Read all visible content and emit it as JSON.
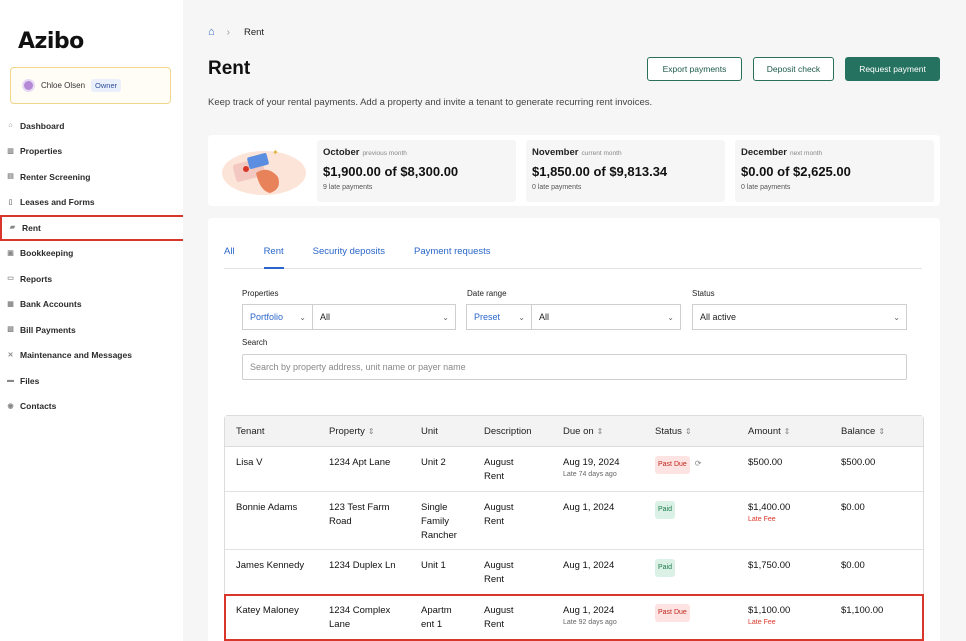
{
  "app": {
    "logo": "Azibo"
  },
  "user": {
    "name": "Chloe Olsen",
    "role": "Owner"
  },
  "sidebar": {
    "items": [
      {
        "label": "Dashboard",
        "icon": "home-icon"
      },
      {
        "label": "Properties",
        "icon": "chart-icon"
      },
      {
        "label": "Renter Screening",
        "icon": "document-icon"
      },
      {
        "label": "Leases and Forms",
        "icon": "file-icon"
      },
      {
        "label": "Rent",
        "icon": "rent-icon",
        "active": true
      },
      {
        "label": "Bookkeeping",
        "icon": "book-icon"
      },
      {
        "label": "Reports",
        "icon": "report-icon"
      },
      {
        "label": "Bank Accounts",
        "icon": "bank-icon"
      },
      {
        "label": "Bill Payments",
        "icon": "bill-icon"
      },
      {
        "label": "Maintenance and Messages",
        "icon": "wrench-icon"
      },
      {
        "label": "Files",
        "icon": "folder-icon"
      },
      {
        "label": "Contacts",
        "icon": "contacts-icon"
      }
    ]
  },
  "breadcrumb": {
    "current": "Rent"
  },
  "header": {
    "title": "Rent",
    "subtitle": "Keep track of your rental payments. Add a property and invite a tenant to generate recurring rent invoices.",
    "export_label": "Export payments",
    "deposit_label": "Deposit check",
    "request_label": "Request payment"
  },
  "summary": [
    {
      "month": "October",
      "note": "previous month",
      "amount": "$1,900.00 of $8,300.00",
      "late": "9 late payments"
    },
    {
      "month": "November",
      "note": "current month",
      "amount": "$1,850.00 of $9,813.34",
      "late": "0 late payments"
    },
    {
      "month": "December",
      "note": "next month",
      "amount": "$0.00 of $2,625.00",
      "late": "0 late payments"
    }
  ],
  "tabs": [
    "All",
    "Rent",
    "Security deposits",
    "Payment requests"
  ],
  "filters": {
    "properties_label": "Properties",
    "properties_scope": "Portfolio",
    "properties_value": "All",
    "date_label": "Date range",
    "date_scope": "Preset",
    "date_value": "All",
    "status_label": "Status",
    "status_value": "All active",
    "search_label": "Search",
    "search_placeholder": "Search by property address, unit name or payer name"
  },
  "table": {
    "columns": [
      "Tenant",
      "Property",
      "Unit",
      "Description",
      "Due on",
      "Status",
      "Amount",
      "Balance"
    ],
    "rows": [
      {
        "tenant": "Lisa V",
        "property": "1234 Apt Lane",
        "unit": "Unit 2",
        "description": "August Rent",
        "due": "Aug 19, 2024",
        "due_sub": "Late 74 days ago",
        "status": "Past Due",
        "amount": "$500.00",
        "amount_sub": "",
        "balance": "$500.00"
      },
      {
        "tenant": "Bonnie Adams",
        "property": "123 Test Farm Road",
        "unit": "Single Family Rancher",
        "description": "August Rent",
        "due": "Aug 1, 2024",
        "due_sub": "",
        "status": "Paid",
        "amount": "$1,400.00",
        "amount_sub": "Late Fee",
        "balance": "$0.00"
      },
      {
        "tenant": "James Kennedy",
        "property": "1234 Duplex Ln",
        "unit": "Unit 1",
        "description": "August Rent",
        "due": "Aug 1, 2024",
        "due_sub": "",
        "status": "Paid",
        "amount": "$1,750.00",
        "amount_sub": "",
        "balance": "$0.00"
      },
      {
        "tenant": "Katey Maloney",
        "property": "1234 Complex Lane",
        "unit": "Apartm ent 1",
        "description": "August Rent",
        "due": "Aug 1, 2024",
        "due_sub": "Late 92 days ago",
        "status": "Past Due",
        "amount": "$1,100.00",
        "amount_sub": "Late Fee",
        "balance": "$1,100.00"
      }
    ]
  },
  "colors": {
    "brand": "#267260",
    "link": "#2a66c9",
    "highlight": "#d9362b"
  }
}
